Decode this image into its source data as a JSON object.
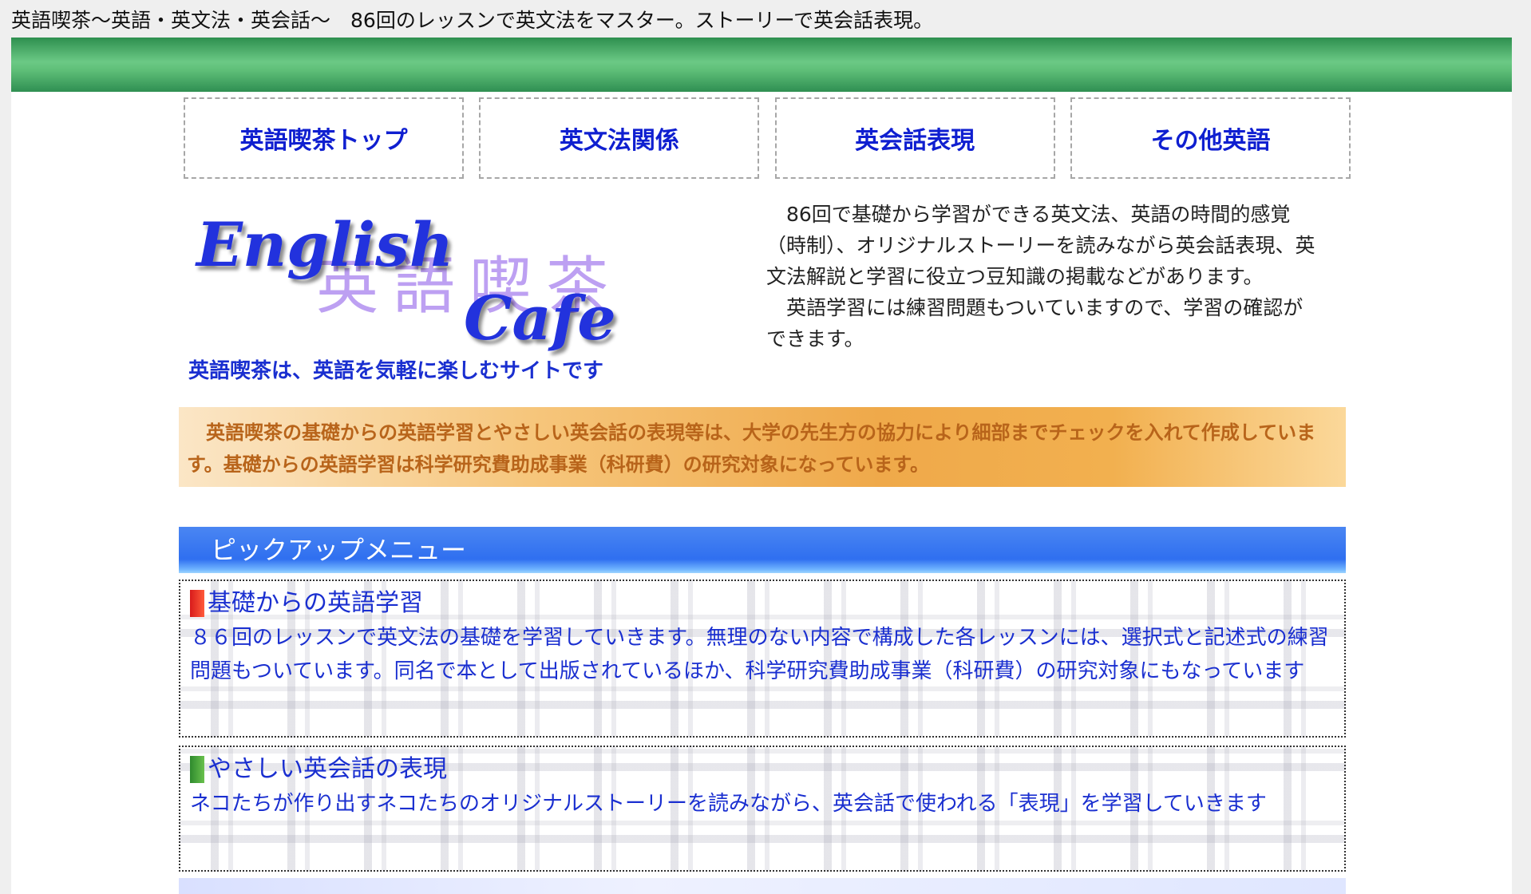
{
  "page_title": "英語喫茶〜英語・英文法・英会話〜　86回のレッスンで英文法をマスター。ストーリーで英会話表現。",
  "nav": [
    {
      "label": "英語喫茶トップ"
    },
    {
      "label": "英文法関係"
    },
    {
      "label": "英会話表現"
    },
    {
      "label": "その他英語"
    }
  ],
  "logo": {
    "word1": "English",
    "kanji": "英語喫茶",
    "word2": "Cafe"
  },
  "tagline": "英語喫茶は、英語を気軽に楽しむサイトです",
  "intro": {
    "p1": "86回で基礎から学習ができる英文法、英語の時間的感覚（時制）、オリジナルストーリーを読みながら英会話表現、英文法解説と学習に役立つ豆知識の掲載などがあります。",
    "p2": "英語学習には練習問題もついていますので、学習の確認ができます。"
  },
  "notice": "英語喫茶の基礎からの英語学習とやさしい英会話の表現等は、大学の先生方の協力により細部までチェックを入れて作成しています。基礎からの英語学習は科学研究費助成事業（科研費）の研究対象になっています。",
  "pickup": {
    "header": "ピックアップメニュー",
    "items": [
      {
        "title": "基礎からの英語学習",
        "description": "８６回のレッスンで英文法の基礎を学習していきます。無理のない内容で構成した各レッスンには、選択式と記述式の練習問題もついています。同名で本として出版されているほか、科学研究費助成事業（科研費）の研究対象にもなっています",
        "marker_color": "#e02a1f"
      },
      {
        "title": "やさしい英会話の表現",
        "description": "ネコたちが作り出すネコたちのオリジナルストーリーを読みながら、英会話で使われる「表現」を学習していきます",
        "marker_color": "#3f9a35"
      }
    ]
  },
  "colors": {
    "link_blue": "#1a2fd0",
    "band_green": "#5fbf78",
    "pickup_blue": "#2f6ff0",
    "notice_orange": "#efa94a"
  }
}
